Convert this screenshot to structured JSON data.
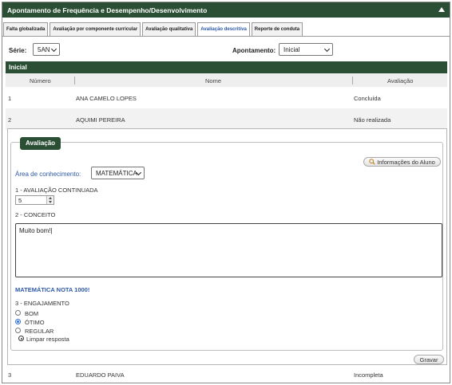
{
  "window": {
    "title": "Apontamento de Frequência e Desempenho/Desenvolvimento"
  },
  "tabs": [
    {
      "label": "Falta globalizada"
    },
    {
      "label": "Avaliação por componente curricular"
    },
    {
      "label": "Avaliação qualitativa"
    },
    {
      "label": "Avaliação descritiva"
    },
    {
      "label": "Reporte de conduta"
    }
  ],
  "filters": {
    "serie_label": "Série:",
    "serie_value": "5AN",
    "apontamento_label": "Apontamento:",
    "apontamento_value": "Inicial"
  },
  "section": {
    "title": "Inicial"
  },
  "table": {
    "columns": [
      "Número",
      "Nome",
      "Avaliação"
    ],
    "rows": [
      {
        "numero": "1",
        "nome": "ANA CAMELO LOPES",
        "avaliacao": "Concluída"
      },
      {
        "numero": "2",
        "nome": "AQUIMI PEREIRA",
        "avaliacao": "Não realizada"
      },
      {
        "numero": "3",
        "nome": "EDUARDO PAIVA",
        "avaliacao": "Incompleta"
      }
    ]
  },
  "evaluation": {
    "legend": "Avaliação",
    "student_info_button": "Informações do Aluno",
    "area_label": "Área de conhecimento:",
    "area_value": "MATEMÁTICA",
    "q1_label": "1 - AVALIAÇÃO CONTINUADA",
    "q1_value": "5",
    "q2_label": "2 - CONCEITO",
    "q2_text": "Muito bom!|",
    "note": "MATEMÁTICA NOTA 1000!",
    "q3_label": "3 - ENGAJAMENTO",
    "options": [
      {
        "label": "BOM",
        "selected": false
      },
      {
        "label": "ÓTIMO",
        "selected": true
      },
      {
        "label": "REGULAR",
        "selected": false
      }
    ],
    "clear_label": "Limpar resposta",
    "save_button": "Gravar"
  },
  "colors": {
    "header_green": "#2b4f35",
    "link_blue": "#2e5aa8",
    "radio_blue": "#2e6fd6"
  }
}
